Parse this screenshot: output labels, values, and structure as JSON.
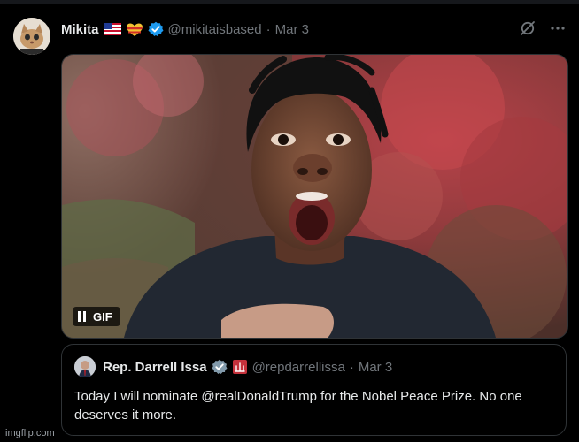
{
  "tweet": {
    "author_name": "Mikita",
    "flags": [
      "us-flag-icon",
      "heart-flag-icon"
    ],
    "handle": "@mikitaisbased",
    "separator": "·",
    "date": "Mar 3"
  },
  "media": {
    "type": "gif",
    "badge_label": "GIF",
    "state": "playing"
  },
  "quoted_tweet": {
    "author_name": "Rep. Darrell Issa",
    "handle": "@repdarrellissa",
    "separator": "·",
    "date": "Mar 3",
    "text": "Today I will nominate @realDonaldTrump for the Nobel Peace Prize. No one deserves it more."
  },
  "watermark": "imgflip.com",
  "colors": {
    "background": "#000000",
    "text": "#e7e9ea",
    "muted": "#71767b",
    "border": "#2f3336",
    "verified_blue": "#1d9bf0",
    "verified_gray": "#829aab"
  }
}
